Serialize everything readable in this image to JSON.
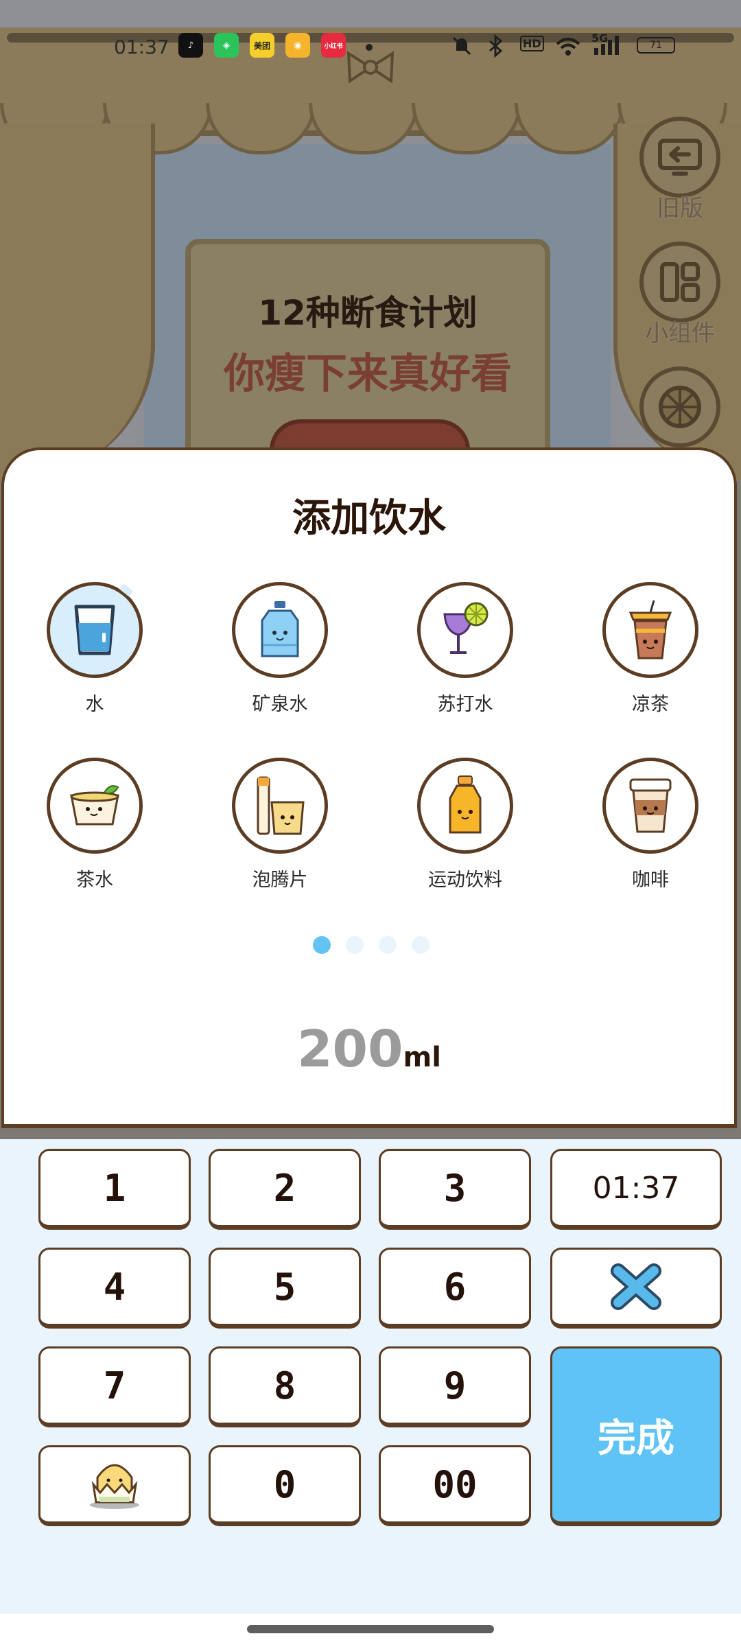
{
  "status_bar": {
    "time": "01:37",
    "apps": [
      "tiktok",
      "wechat-pay",
      "美团",
      "微博",
      "小红书"
    ],
    "indicators": [
      "mute-icon",
      "bluetooth-icon",
      "HD",
      "wifi-icon",
      "5G",
      "signal-icon",
      "battery-icon"
    ],
    "hd_label": "HD",
    "network_label": "5G",
    "battery_level": "71"
  },
  "background": {
    "board_line1": "12种断食计划",
    "board_line2": "你瘦下来真好看"
  },
  "side_buttons": [
    {
      "icon": "back-screen-icon",
      "label": "旧版"
    },
    {
      "icon": "widget-icon",
      "label": "小组件"
    },
    {
      "icon": "wheel-icon",
      "label": ""
    }
  ],
  "sheet": {
    "title": "添加饮水",
    "drinks": [
      {
        "label": "水",
        "icon": "water-glass-icon",
        "selected": true
      },
      {
        "label": "矿泉水",
        "icon": "mineral-water-bottle-icon",
        "selected": false
      },
      {
        "label": "苏打水",
        "icon": "soda-glass-icon",
        "selected": false
      },
      {
        "label": "凉茶",
        "icon": "herbal-tea-cup-icon",
        "selected": false
      },
      {
        "label": "茶水",
        "icon": "tea-cup-icon",
        "selected": false
      },
      {
        "label": "泡腾片",
        "icon": "effervescent-tablet-icon",
        "selected": false
      },
      {
        "label": "运动饮料",
        "icon": "sports-drink-icon",
        "selected": false
      },
      {
        "label": "咖啡",
        "icon": "coffee-cup-icon",
        "selected": false
      }
    ],
    "page_count": 4,
    "active_page": 1,
    "amount_value": "200",
    "amount_unit": "ml"
  },
  "keypad": {
    "k1": "1",
    "k2": "2",
    "k3": "3",
    "time": "01:37",
    "k4": "4",
    "k5": "5",
    "k6": "6",
    "k7": "7",
    "k8": "8",
    "k9": "9",
    "k0": "0",
    "k00": "00",
    "done": "完成",
    "delete_icon": "close-x-icon",
    "mascot_icon": "mascot-egg-icon"
  },
  "colors": {
    "accent_blue": "#5fc4f5",
    "outline_brown": "#5c3d24",
    "keypad_bg": "#eaf4fc"
  }
}
